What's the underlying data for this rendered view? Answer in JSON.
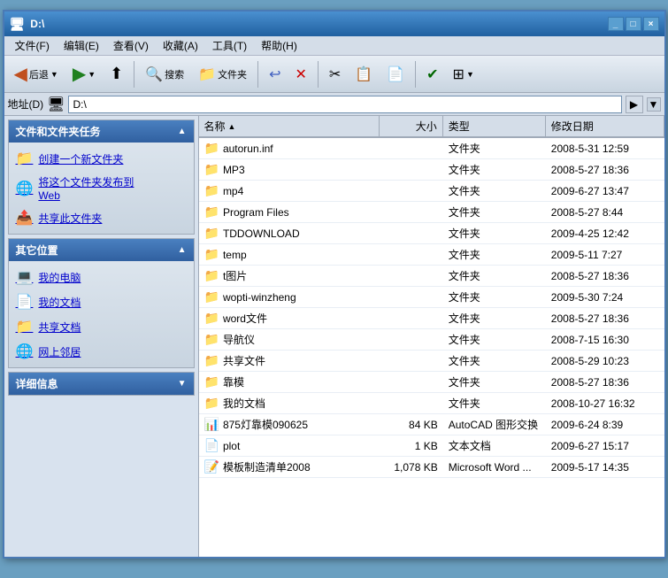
{
  "window": {
    "title": "D:\\",
    "titlebar_icon": "🖥"
  },
  "menubar": {
    "items": [
      "文件(F)",
      "编辑(E)",
      "查看(V)",
      "收藏(A)",
      "工具(T)",
      "帮助(H)"
    ]
  },
  "toolbar": {
    "back_label": "后退",
    "forward_label": "",
    "up_label": "",
    "search_label": "搜索",
    "folder_label": "文件夹"
  },
  "addressbar": {
    "label": "地址(D)",
    "value": "D:\\"
  },
  "left_panel": {
    "task_section": {
      "title": "文件和文件夹任务",
      "items": [
        {
          "icon": "📁",
          "label": "创建一个新文件夹"
        },
        {
          "icon": "🌐",
          "label": "将这个文件夹发布到\nWeb"
        },
        {
          "icon": "📤",
          "label": "共享此文件夹"
        }
      ]
    },
    "places_section": {
      "title": "其它位置",
      "items": [
        {
          "icon": "💻",
          "label": "我的电脑"
        },
        {
          "icon": "📄",
          "label": "我的文档"
        },
        {
          "icon": "📁",
          "label": "共享文档"
        },
        {
          "icon": "🌐",
          "label": "网上邻居"
        }
      ]
    },
    "details_section": {
      "title": "详细信息"
    }
  },
  "file_list": {
    "columns": [
      "名称",
      "大小",
      "类型",
      "修改日期"
    ],
    "sort_col": "名称",
    "sort_dir": "asc",
    "files": [
      {
        "name": "autorun.inf",
        "size": "",
        "type": "文件夹",
        "date": "2008-5-31 12:59",
        "is_folder": true
      },
      {
        "name": "MP3",
        "size": "",
        "type": "文件夹",
        "date": "2008-5-27 18:36",
        "is_folder": true
      },
      {
        "name": "mp4",
        "size": "",
        "type": "文件夹",
        "date": "2009-6-27 13:47",
        "is_folder": true
      },
      {
        "name": "Program Files",
        "size": "",
        "type": "文件夹",
        "date": "2008-5-27 8:44",
        "is_folder": true
      },
      {
        "name": "TDDOWNLOAD",
        "size": "",
        "type": "文件夹",
        "date": "2009-4-25 12:42",
        "is_folder": true
      },
      {
        "name": "temp",
        "size": "",
        "type": "文件夹",
        "date": "2009-5-11 7:27",
        "is_folder": true
      },
      {
        "name": "t图片",
        "size": "",
        "type": "文件夹",
        "date": "2008-5-27 18:36",
        "is_folder": true
      },
      {
        "name": "wopti-winzheng",
        "size": "",
        "type": "文件夹",
        "date": "2009-5-30 7:24",
        "is_folder": true
      },
      {
        "name": "word文件",
        "size": "",
        "type": "文件夹",
        "date": "2008-5-27 18:36",
        "is_folder": true
      },
      {
        "name": "导航仪",
        "size": "",
        "type": "文件夹",
        "date": "2008-7-15 16:30",
        "is_folder": true
      },
      {
        "name": "共享文件",
        "size": "",
        "type": "文件夹",
        "date": "2008-5-29 10:23",
        "is_folder": true
      },
      {
        "name": "靠模",
        "size": "",
        "type": "文件夹",
        "date": "2008-5-27 18:36",
        "is_folder": true
      },
      {
        "name": "我的文档",
        "size": "",
        "type": "文件夹",
        "date": "2008-10-27 16:32",
        "is_folder": true
      },
      {
        "name": "875灯靠模090625",
        "size": "84 KB",
        "type": "AutoCAD 图形交换",
        "date": "2009-6-24 8:39",
        "is_folder": false,
        "file_icon": "📊"
      },
      {
        "name": "plot",
        "size": "1 KB",
        "type": "文本文档",
        "date": "2009-6-27 15:17",
        "is_folder": false,
        "file_icon": "📄"
      },
      {
        "name": "模板制造清单2008",
        "size": "1,078 KB",
        "type": "Microsoft Word ...",
        "date": "2009-5-17 14:35",
        "is_folder": false,
        "file_icon": "📝"
      }
    ]
  }
}
